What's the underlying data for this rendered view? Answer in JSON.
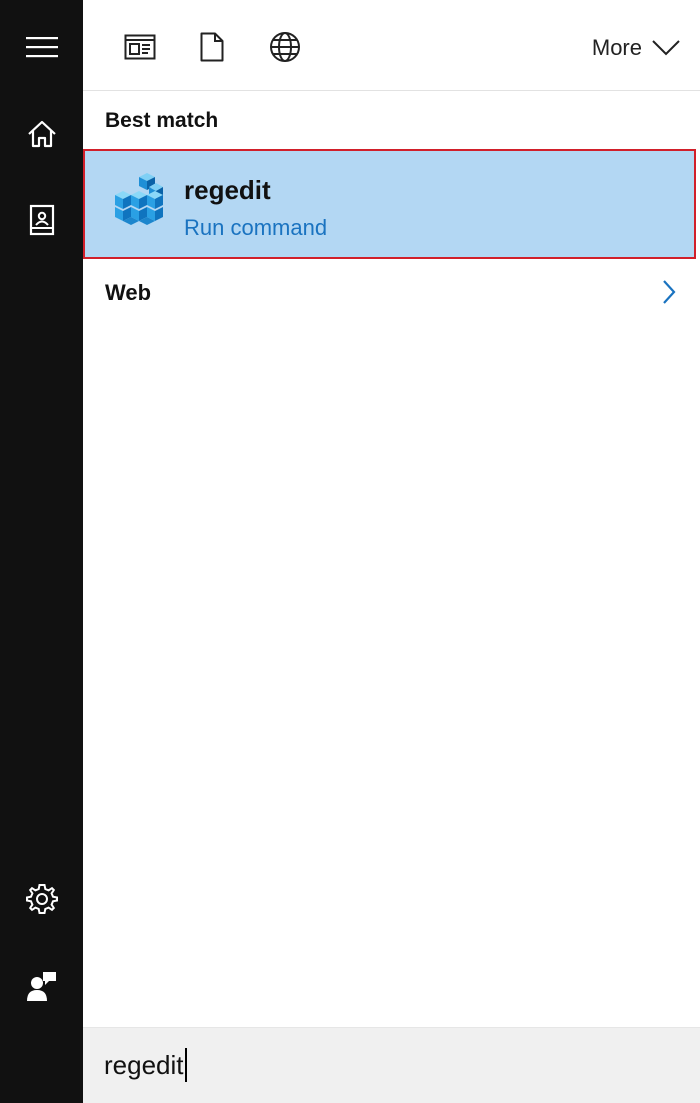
{
  "rail": {
    "icons": [
      "hamburger-menu-icon",
      "home-icon",
      "notebook-icon",
      "gear-icon",
      "feedback-icon"
    ]
  },
  "toolbar": {
    "filters": [
      "apps-filter-icon",
      "documents-filter-icon",
      "web-filter-icon"
    ],
    "more_label": "More"
  },
  "results": {
    "best_match_header": "Best match",
    "best_match": {
      "title": "regedit",
      "subtitle": "Run command",
      "icon": "registry-editor-icon"
    },
    "web_label": "Web"
  },
  "search": {
    "value": "regedit"
  },
  "colors": {
    "rail_bg": "#111111",
    "selection_bg": "#b3d7f3",
    "selection_border": "#d11f2a",
    "link_blue": "#1a73c0"
  }
}
